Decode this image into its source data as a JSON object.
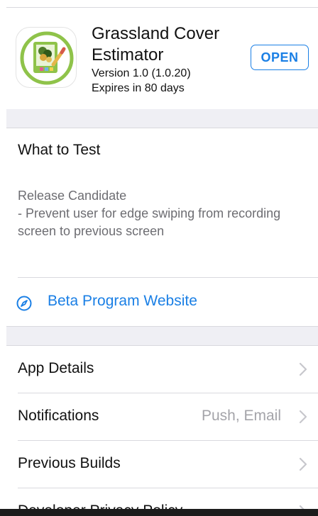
{
  "app": {
    "title": "Grassland Cover Estimator",
    "version": "Version 1.0 (1.0.20)",
    "expires": "Expires in 80 days",
    "open_label": "OPEN",
    "icon": "grassland-app-icon"
  },
  "what_to_test": {
    "heading": "What to Test",
    "notes": "Release Candidate\n- Prevent user for edge swiping from recording screen to previous screen"
  },
  "beta_link": {
    "label": "Beta Program Website",
    "icon": "compass-icon"
  },
  "rows": [
    {
      "label": "App Details",
      "detail": ""
    },
    {
      "label": "Notifications",
      "detail": "Push, Email"
    },
    {
      "label": "Previous Builds",
      "detail": ""
    },
    {
      "label": "Developer Privacy Policy",
      "detail": ""
    }
  ],
  "colors": {
    "accent": "#1a7fe5",
    "separator_background": "#efeff4",
    "secondary_text": "#a4a4a9",
    "notes_text": "#6d6d72"
  }
}
